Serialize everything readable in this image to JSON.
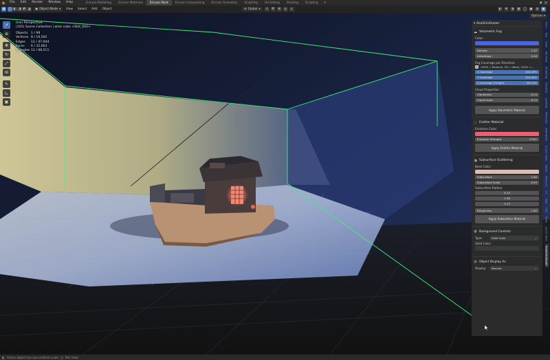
{
  "menubar": {
    "menus": [
      "File",
      "Edit",
      "Render",
      "Window",
      "Help"
    ],
    "workspaces": [
      "Ericson Modelling",
      "Ericson Materials",
      "Ericson Paint",
      "Ericson Compositing",
      "Ericson Animation",
      "Sculpting",
      "UV Editing",
      "Shading",
      "Scripting"
    ],
    "active_workspace": "Ericson Paint"
  },
  "header": {
    "mode": "Object Mode",
    "menus": [
      "View",
      "Select",
      "Add",
      "Object"
    ],
    "transform_orientation": "Global"
  },
  "overlay": {
    "perspective": "User Perspective",
    "collection": "(101) Scene Collection | wine cube <Slot_002>",
    "stats": [
      {
        "label": "Objects",
        "value": "1 / 98"
      },
      {
        "label": "Vertices",
        "value": "8 / 16,502"
      },
      {
        "label": "Edges",
        "value": "12 / 47,944"
      },
      {
        "label": "Faces",
        "value": "6 / 32,663"
      },
      {
        "label": "Triangles",
        "value": "12 / 68,511"
      }
    ]
  },
  "options_label": "Options",
  "panel": {
    "title": "RealSimShader",
    "fog": {
      "header": "Volumetric Fog",
      "color_label": "Color:",
      "color": "#4a64e8",
      "density_label": "Density",
      "density_value": "1.47",
      "anisotropy_label": "Anisotropy",
      "anisotropy_value": "0.16",
      "coverage_label": "Fog Coverage per Direction:",
      "coverage_desc": "-100% = Reverse, 0% = None, 100% =...",
      "x_label": "X Coverage",
      "x_value": "100.00%",
      "x_fraction": 1.0,
      "y_label": "Y Coverage",
      "y_value": "100.00%",
      "y_fraction": 1.0,
      "z_label": "Z Coverage (Height)",
      "z_value": "99.24%",
      "z_fraction": 0.992,
      "cloud_label": "Cloud Properties:",
      "cloudiness_label": "Cloudiness",
      "cloudiness_value": "0.24",
      "cloud_scale_label": "Cloud Scale",
      "cloud_scale_value": "6.13",
      "apply_label": "Apply Volumetric Material"
    },
    "emitter": {
      "header": "Emitter Material",
      "color_label": "Emission Color:",
      "color": "#ee5f72",
      "strength_label": "Emission Strength",
      "strength_value": "23.67",
      "apply_label": "Apply Emitter Material"
    },
    "sss": {
      "header": "Subsurface Scattering",
      "base_label": "Base Color:",
      "base_color": "#d9bfb2",
      "subsurface_label": "Subsurface",
      "subsurface_value": "1.00",
      "scale_label": "Subsurface Scale",
      "scale_value": "0.93",
      "radius_label": "Subsurface Radius:",
      "radius": [
        "4.24",
        "1.58",
        "3.13"
      ],
      "roughness_label": "Roughness",
      "roughness_value": "1.00",
      "apply_label": "Apply Subsurface Material"
    },
    "background": {
      "header": "Background Controls",
      "type_label": "Type:",
      "type_value": "Solid Color",
      "solid_label": "Solid Color:",
      "solid_color": "#3a3a3a"
    },
    "display": {
      "header": "Object Display As",
      "display_label": "Display:",
      "display_value": "Bounds"
    }
  },
  "vtabs": [
    "Item",
    "Tool",
    "View",
    "My Tools",
    "Modeling",
    "Painting",
    "Lighting",
    "Materials",
    "Animation",
    "Scene Tools",
    "Node",
    "Textures",
    "FX",
    "Tool",
    "UVs",
    "View",
    "Quick Tools",
    "RealSimShader"
  ],
  "vtabs_active": "RealSimShader",
  "status": {
    "left": "Active object has non-uniform scale",
    "mid": "Pan View"
  },
  "colors": {
    "accent": "#4772b3",
    "wire": "#3df27a"
  }
}
